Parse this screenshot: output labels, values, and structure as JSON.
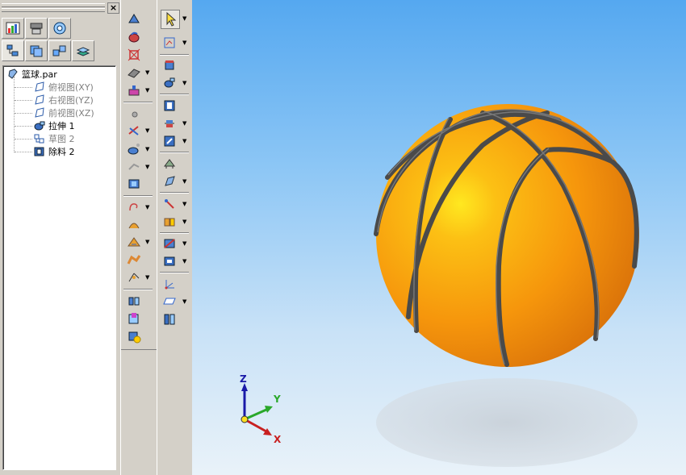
{
  "tree": {
    "root": "篮球.par",
    "items": [
      {
        "label": "俯视图(XY)",
        "muted": true
      },
      {
        "label": "右视图(YZ)",
        "muted": true
      },
      {
        "label": "前视图(XZ)",
        "muted": true
      },
      {
        "label": "拉伸 1",
        "muted": false
      },
      {
        "label": "草图 2",
        "muted": true
      },
      {
        "label": "除料 2",
        "muted": false
      }
    ]
  },
  "panel": {
    "close_label": "×"
  },
  "triad": {
    "z": "Z",
    "y": "Y",
    "x": "X"
  },
  "colors": {
    "ball": "#f7a20a",
    "seam": "#4a4a4a",
    "bg_top": "#55a8f0",
    "bg_bottom": "#e9f2f9"
  }
}
